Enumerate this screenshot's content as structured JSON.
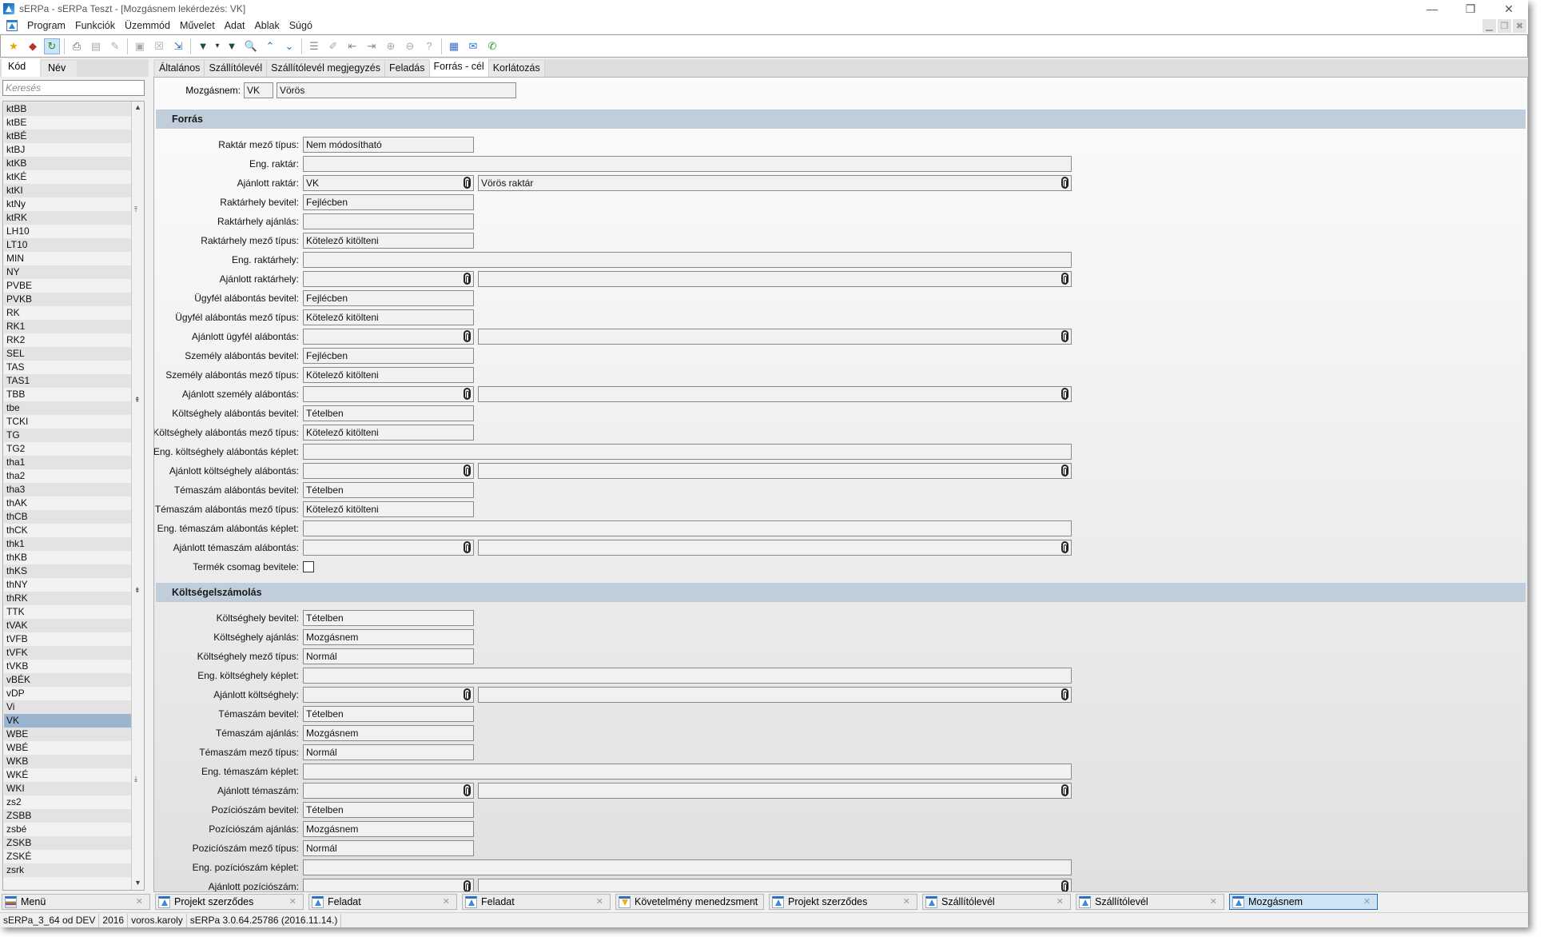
{
  "window": {
    "title": "sERPa - sERPa Teszt - [Mozgásnem lekérdezés: VK]",
    "controls": [
      "minimize",
      "restore",
      "close"
    ]
  },
  "menu": {
    "items": [
      "Program",
      "Funkciók",
      "Üzemmód",
      "Művelet",
      "Adat",
      "Ablak",
      "Súgó"
    ]
  },
  "toolbar": {
    "buttons": [
      {
        "name": "new-favorite-icon",
        "glyph": "★",
        "color": "#e5a800"
      },
      {
        "name": "bookmark-icon",
        "glyph": "◆",
        "color": "#b8332b"
      },
      {
        "name": "refresh-icon",
        "glyph": "↻",
        "color": "#2a8a2a",
        "active": true
      },
      {
        "name": "sep"
      },
      {
        "name": "print-icon",
        "glyph": "⎙",
        "color": "#555"
      },
      {
        "name": "print-preview-icon",
        "glyph": "▤",
        "color": "#aaa"
      },
      {
        "name": "attach-icon",
        "glyph": "✎",
        "color": "#aaa"
      },
      {
        "name": "sep"
      },
      {
        "name": "save-icon",
        "glyph": "▣",
        "color": "#aaa"
      },
      {
        "name": "delete-icon",
        "glyph": "☒",
        "color": "#aaa"
      },
      {
        "name": "export-icon",
        "glyph": "⇲",
        "color": "#2a6fb8"
      },
      {
        "name": "sep"
      },
      {
        "name": "filter-icon",
        "glyph": "▼",
        "color": "#1e4a4a"
      },
      {
        "name": "filter-dropdown-icon",
        "glyph": "▾",
        "color": "#333"
      },
      {
        "name": "filter-doc-icon",
        "glyph": "▼",
        "color": "#1e4a4a"
      },
      {
        "name": "search-icon",
        "glyph": "🔍",
        "color": "#2a6fb8"
      },
      {
        "name": "chevron-up-icon",
        "glyph": "⌃",
        "color": "#2a6fb8"
      },
      {
        "name": "chevron-down-icon",
        "glyph": "⌄",
        "color": "#2a6fb8"
      },
      {
        "name": "sep"
      },
      {
        "name": "insert-row-icon",
        "glyph": "☰",
        "color": "#888"
      },
      {
        "name": "edit-icon",
        "glyph": "✐",
        "color": "#aaa"
      },
      {
        "name": "move-left-icon",
        "glyph": "⇤",
        "color": "#888"
      },
      {
        "name": "move-right-icon",
        "glyph": "⇥",
        "color": "#888"
      },
      {
        "name": "plus-circle-icon",
        "glyph": "⊕",
        "color": "#aaa"
      },
      {
        "name": "minus-circle-icon",
        "glyph": "⊖",
        "color": "#aaa"
      },
      {
        "name": "help-icon",
        "glyph": "?",
        "color": "#aaa"
      },
      {
        "name": "sep"
      },
      {
        "name": "calculator-icon",
        "glyph": "▦",
        "color": "#3a6fc8"
      },
      {
        "name": "mail-icon",
        "glyph": "✉",
        "color": "#2a7ad0"
      },
      {
        "name": "phone-icon",
        "glyph": "✆",
        "color": "#2a9a2a"
      }
    ]
  },
  "left_panel": {
    "tabs": [
      "Kód",
      "Név"
    ],
    "search_placeholder": "Keresés",
    "items": [
      "ktBB",
      "ktBE",
      "ktBÉ",
      "ktBJ",
      "ktKB",
      "ktKÉ",
      "ktKI",
      "ktNy",
      "ktRK",
      "LH10",
      "LT10",
      "MIN",
      "NY",
      "PVBE",
      "PVKB",
      "RK",
      "RK1",
      "RK2",
      "SEL",
      "TAS",
      "TAS1",
      "TBB",
      "tbe",
      "TCKI",
      "TG",
      "TG2",
      "tha1",
      "tha2",
      "tha3",
      "thAK",
      "thCB",
      "thCK",
      "thk1",
      "thKB",
      "thKS",
      "thNY",
      "thRK",
      "TTK",
      "tVAK",
      "tVFB",
      "tVFK",
      "tVKB",
      "vBÉK",
      "vDP",
      "Vi",
      "VK",
      "WBE",
      "WBÉ",
      "WKB",
      "WKÉ",
      "WKI",
      "zs2",
      "ZSBB",
      "zsbé",
      "ZSKB",
      "ZSKÉ",
      "zsrk"
    ],
    "selected": "VK"
  },
  "main": {
    "tabs": [
      "Általános",
      "Szállítólevél",
      "Szállítólevél megjegyzés",
      "Feladás",
      "Forrás - cél",
      "Korlátozás"
    ],
    "active_tab": "Forrás - cél",
    "header": {
      "label": "Mozgásnem:",
      "code": "VK",
      "name": "Vörös"
    },
    "sections": [
      {
        "title": "Forrás",
        "rows": [
          {
            "label": "Raktár mező típus:",
            "type": "short",
            "value": "Nem módosítható"
          },
          {
            "label": "Eng. raktár:",
            "type": "wide",
            "value": ""
          },
          {
            "label": "Ajánlott raktár:",
            "type": "lookup",
            "value": "VK",
            "value2": "Vörös raktár"
          },
          {
            "label": "Raktárhely bevitel:",
            "type": "short",
            "value": "Fejlécben"
          },
          {
            "label": "Raktárhely ajánlás:",
            "type": "short",
            "value": ""
          },
          {
            "label": "Raktárhely mező típus:",
            "type": "short",
            "value": "Kötelező kitölteni"
          },
          {
            "label": "Eng. raktárhely:",
            "type": "wide",
            "value": ""
          },
          {
            "label": "Ajánlott raktárhely:",
            "type": "lookup",
            "value": "",
            "value2": ""
          },
          {
            "label": "Ügyfél alábontás bevitel:",
            "type": "short",
            "value": "Fejlécben"
          },
          {
            "label": "Ügyfél alábontás mező típus:",
            "type": "short",
            "value": "Kötelező kitölteni"
          },
          {
            "label": "Ajánlott ügyfél alábontás:",
            "type": "lookup",
            "value": "",
            "value2": ""
          },
          {
            "label": "Személy alábontás bevitel:",
            "type": "short",
            "value": "Fejlécben"
          },
          {
            "label": "Személy alábontás mező típus:",
            "type": "short",
            "value": "Kötelező kitölteni"
          },
          {
            "label": "Ajánlott személy alábontás:",
            "type": "lookup",
            "value": "",
            "value2": ""
          },
          {
            "label": "Költséghely alábontás bevitel:",
            "type": "short",
            "value": "Tételben"
          },
          {
            "label": "Költséghely alábontás mező típus:",
            "type": "short",
            "value": "Kötelező kitölteni"
          },
          {
            "label": "Eng. költséghely alábontás képlet:",
            "type": "wide",
            "value": ""
          },
          {
            "label": "Ajánlott költséghely alábontás:",
            "type": "lookup",
            "value": "",
            "value2": ""
          },
          {
            "label": "Témaszám alábontás bevitel:",
            "type": "short",
            "value": "Tételben"
          },
          {
            "label": "Témaszám alábontás mező típus:",
            "type": "short",
            "value": "Kötelező kitölteni"
          },
          {
            "label": "Eng. témaszám alábontás képlet:",
            "type": "wide",
            "value": ""
          },
          {
            "label": "Ajánlott témaszám alábontás:",
            "type": "lookup",
            "value": "",
            "value2": ""
          },
          {
            "label": "Termék csomag bevitele:",
            "type": "checkbox",
            "checked": false
          }
        ]
      },
      {
        "title": "Költségelszámolás",
        "rows": [
          {
            "label": "Költséghely bevitel:",
            "type": "short",
            "value": "Tételben"
          },
          {
            "label": "Költséghely ajánlás:",
            "type": "short",
            "value": "Mozgásnem"
          },
          {
            "label": "Költséghely mező típus:",
            "type": "short",
            "value": "Normál"
          },
          {
            "label": "Eng. költséghely képlet:",
            "type": "wide",
            "value": ""
          },
          {
            "label": "Ajánlott költséghely:",
            "type": "lookup",
            "value": "",
            "value2": ""
          },
          {
            "label": "Témaszám bevitel:",
            "type": "short",
            "value": "Tételben"
          },
          {
            "label": "Témaszám ajánlás:",
            "type": "short",
            "value": "Mozgásnem"
          },
          {
            "label": "Témaszám mező típus:",
            "type": "short",
            "value": "Normál"
          },
          {
            "label": "Eng. témaszám képlet:",
            "type": "wide",
            "value": ""
          },
          {
            "label": "Ajánlott témaszám:",
            "type": "lookup",
            "value": "",
            "value2": ""
          },
          {
            "label": "Pozíciószám bevitel:",
            "type": "short",
            "value": "Tételben"
          },
          {
            "label": "Pozíciószám ajánlás:",
            "type": "short",
            "value": "Mozgásnem"
          },
          {
            "label": "Pozicíószám mező típus:",
            "type": "short",
            "value": "Normál"
          },
          {
            "label": "Eng. pozíciószám képlet:",
            "type": "wide",
            "value": ""
          },
          {
            "label": "Ajánlott pozíciószám:",
            "type": "lookup",
            "value": "",
            "value2": ""
          }
        ]
      }
    ]
  },
  "window_tabs": [
    {
      "label": "Menü",
      "icon": "menu",
      "active": false
    },
    {
      "label": "Projekt szerződes",
      "icon": "app",
      "active": false
    },
    {
      "label": "Feladat",
      "icon": "app",
      "active": false
    },
    {
      "label": "Feladat",
      "icon": "app",
      "active": false
    },
    {
      "label": "Követelmény menedzsment",
      "icon": "warn",
      "active": false
    },
    {
      "label": "Projekt szerződes",
      "icon": "app",
      "active": false
    },
    {
      "label": "Szállítólevél",
      "icon": "app",
      "active": false
    },
    {
      "label": "Szállítólevél",
      "icon": "app",
      "active": false
    },
    {
      "label": "Mozgásnem",
      "icon": "app",
      "active": true
    }
  ],
  "status_bar": [
    "sERPa_3_64 od DEV",
    "2016",
    "voros.karoly",
    "sERPa 3.0.64.25786 (2016.11.14.)"
  ],
  "colors": {
    "section_header": "#c0cedb",
    "selected_row": "#9bb4d0",
    "active_window_tab": "#cde4f7"
  }
}
